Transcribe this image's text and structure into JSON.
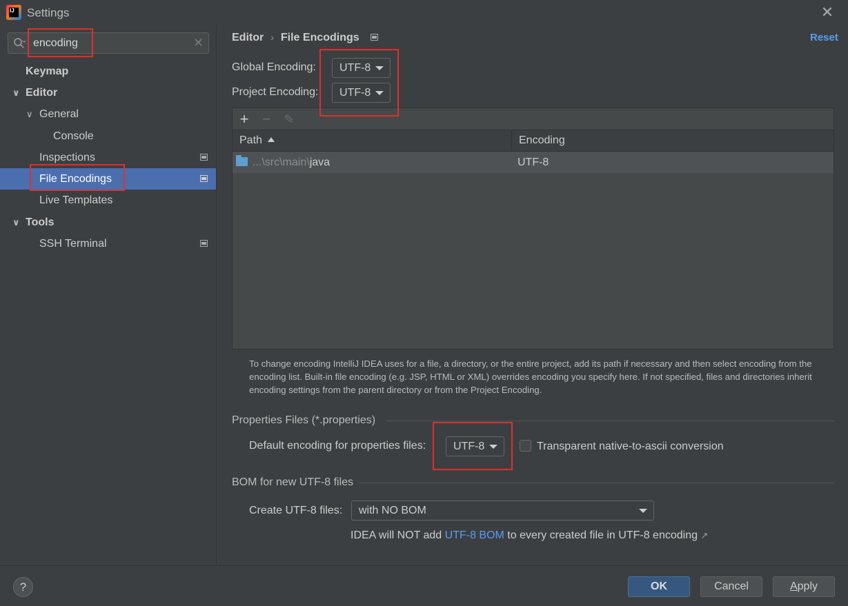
{
  "window": {
    "title": "Settings"
  },
  "sidebar": {
    "search": {
      "value": "encoding"
    },
    "items": [
      {
        "label": "Keymap"
      },
      {
        "label": "Editor"
      },
      {
        "label": "General"
      },
      {
        "label": "Console"
      },
      {
        "label": "Inspections"
      },
      {
        "label": "File Encodings"
      },
      {
        "label": "Live Templates"
      },
      {
        "label": "Tools"
      },
      {
        "label": "SSH Terminal"
      }
    ]
  },
  "main": {
    "breadcrumb": {
      "parent": "Editor",
      "separator": "›",
      "current": "File Encodings"
    },
    "reset_label": "Reset",
    "global_encoding": {
      "label": "Global Encoding:",
      "value": "UTF-8"
    },
    "project_encoding": {
      "label": "Project Encoding:",
      "value": "UTF-8"
    },
    "table": {
      "toolbar": {
        "add": "+",
        "remove": "−",
        "edit": "✎"
      },
      "columns": [
        "Path",
        "Encoding"
      ],
      "rows": [
        {
          "path_prefix": "...\\src\\main\\",
          "path_name": "java",
          "encoding": "UTF-8"
        }
      ]
    },
    "help_text": "To change encoding IntelliJ IDEA uses for a file, a directory, or the entire project, add its path if necessary and then select encoding from the encoding list. Built-in file encoding (e.g. JSP, HTML or XML) overrides encoding you specify here. If not specified, files and directories inherit encoding settings from the parent directory or from the Project Encoding.",
    "properties": {
      "section_title": "Properties Files (*.properties)",
      "default_label": "Default encoding for properties files:",
      "default_value": "UTF-8",
      "transparent_label": "Transparent native-to-ascii conversion",
      "transparent_checked": false
    },
    "bom": {
      "section_title": "BOM for new UTF-8 files",
      "create_label": "Create UTF-8 files:",
      "create_value": "with NO BOM",
      "note_before": "IDEA will NOT add ",
      "note_link": "UTF-8 BOM",
      "note_after": " to every created file in UTF-8 encoding",
      "note_arrow": "↗"
    }
  },
  "footer": {
    "help": "?",
    "ok": "OK",
    "cancel": "Cancel",
    "apply_underlined": "A",
    "apply_rest": "pply"
  },
  "colors": {
    "background": "#3c3f41",
    "selection": "#4b6eaf",
    "link": "#589df6",
    "highlight_box": "#e0302c",
    "primary_button": "#365880"
  }
}
